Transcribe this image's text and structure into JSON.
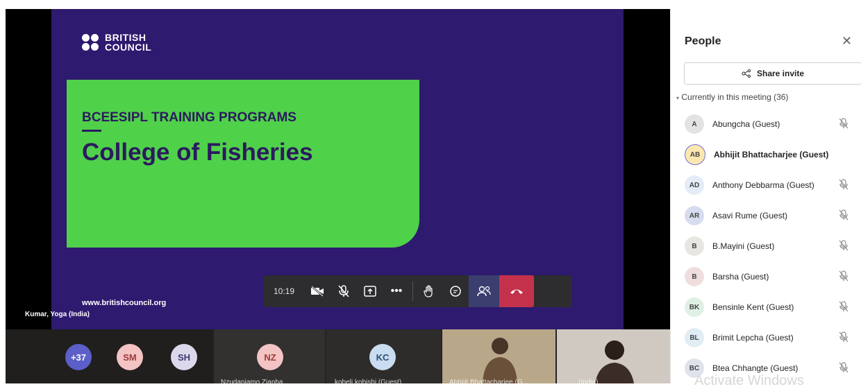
{
  "slide": {
    "logo_line1": "BRITISH",
    "logo_line2": "COUNCIL",
    "program": "BCEESIPL TRAINING PROGRAMS",
    "college": "College of Fisheries",
    "url": "www.britishcouncil.org"
  },
  "speaker_label": "Kumar, Yoga (India)",
  "controls": {
    "time": "10:19",
    "camera_icon": "camera-off-icon",
    "mic_icon": "mic-off-icon",
    "share_icon": "share-tray-icon",
    "more_icon": "more-icon",
    "hand_icon": "raise-hand-icon",
    "chat_icon": "chat-icon",
    "people_icon": "people-icon",
    "hangup_icon": "hang-up-icon"
  },
  "strip": {
    "overflow": "+37",
    "tiles": [
      {
        "initials": "SM"
      },
      {
        "initials": "SH"
      },
      {
        "initials": "NZ",
        "name": "Nzudaniamo Zianha..."
      },
      {
        "initials": "KC",
        "name": "kobeli kobishi (Guest)"
      },
      {
        "name": "Abhijit Bhattacharjee (G..."
      },
      {
        "name": "... (India)"
      }
    ]
  },
  "panel": {
    "title": "People",
    "share_label": "Share invite",
    "section_label": "Currently in this meeting (36)",
    "people": [
      {
        "initials": "A",
        "name": "Abungcha (Guest)",
        "color": "#e3e3e3",
        "muted": true
      },
      {
        "initials": "AB",
        "name": "Abhijit Bhattacharjee (Guest)",
        "color": "#fde7b0",
        "muted": false,
        "bold": true
      },
      {
        "initials": "AD",
        "name": "Anthony Debbarma (Guest)",
        "color": "#e3ecf7",
        "muted": true
      },
      {
        "initials": "AR",
        "name": "Asavi Rume (Guest)",
        "color": "#d7dcef",
        "muted": true
      },
      {
        "initials": "B",
        "name": "B.Mayini (Guest)",
        "color": "#e8e6e1",
        "muted": true
      },
      {
        "initials": "B",
        "name": "Barsha (Guest)",
        "color": "#f0dede",
        "muted": true
      },
      {
        "initials": "BK",
        "name": "Bensinle Kent (Guest)",
        "color": "#dff0e4",
        "muted": true
      },
      {
        "initials": "BL",
        "name": "Brimit Lepcha (Guest)",
        "color": "#e1edf5",
        "muted": true
      },
      {
        "initials": "BC",
        "name": "Btea Chhangte (Guest)",
        "color": "#dfe3ec",
        "muted": true
      }
    ]
  },
  "watermark": "Activate Windows"
}
